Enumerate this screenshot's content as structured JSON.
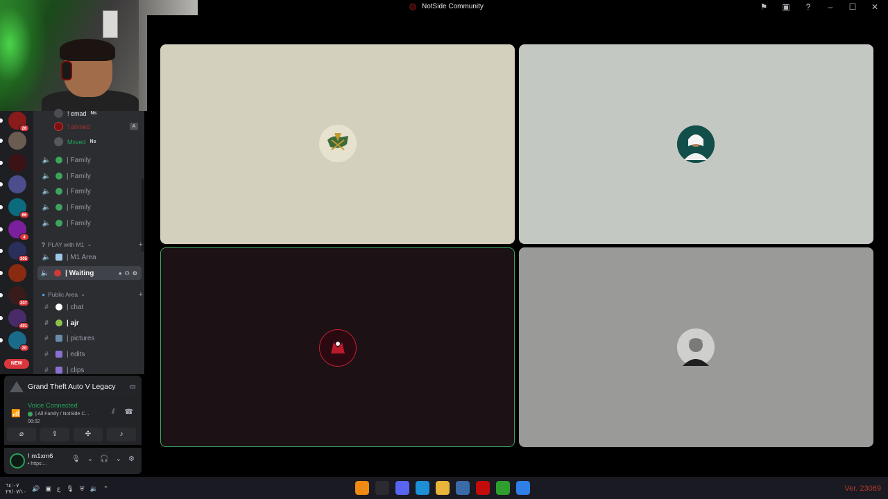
{
  "window": {
    "title": "NotSide Community",
    "titlebar_icons": [
      "inbox-flag-icon",
      "screen-share-icon",
      "help-icon",
      "minimize-icon",
      "maximize-icon",
      "close-icon"
    ]
  },
  "servers": [
    {
      "name": "m1-server",
      "badge": "26",
      "color": "#8a1b1b"
    },
    {
      "name": "server-2",
      "badge": "",
      "color": "#6a5c50"
    },
    {
      "name": "server-3",
      "badge": "",
      "color": "#3b1216"
    },
    {
      "name": "server-4",
      "badge": "",
      "color": "#4b4d8c"
    },
    {
      "name": "server-5",
      "badge": "66",
      "color": "#0c6a7d"
    },
    {
      "name": "server-6",
      "badge": "4",
      "color": "#7b1f9c"
    },
    {
      "name": "server-7",
      "badge": "305",
      "color": "#2b2f5c"
    },
    {
      "name": "server-8",
      "badge": "",
      "color": "#8a2a10"
    },
    {
      "name": "server-9",
      "badge": "207",
      "color": "#3a1b1b"
    },
    {
      "name": "server-10",
      "badge": "491",
      "color": "#4a2b6a"
    },
    {
      "name": "server-11",
      "badge": "20",
      "color": "#1a6a8a"
    }
  ],
  "new_badge": "NEW",
  "voice_users": [
    {
      "name": "! emad",
      "tag": "Ns",
      "color": "#e8e8e8",
      "avatar": "#4a4d52"
    },
    {
      "name": "! ahmed",
      "tag": "",
      "color": "#a83232",
      "avatar": "#7a1010"
    },
    {
      "name": "Mxved",
      "tag": "Ns",
      "color": "#23a55a",
      "avatar": "#55585d"
    }
  ],
  "voice_channels": [
    {
      "name": "| Family"
    },
    {
      "name": "| Family"
    },
    {
      "name": "| Family"
    },
    {
      "name": "| Family"
    },
    {
      "name": "| Family"
    }
  ],
  "categories": {
    "play": "PLAY with M1",
    "public": "Public Area"
  },
  "play_channels": [
    {
      "name": "| M1 Area",
      "active": false
    },
    {
      "name": "| Waiting",
      "active": true
    }
  ],
  "text_channels": [
    {
      "name": "| chat",
      "unread": false
    },
    {
      "name": "| ajr",
      "unread": true
    },
    {
      "name": "| pictures",
      "unread": false
    },
    {
      "name": "| edits",
      "unread": false
    },
    {
      "name": "| clips",
      "unread": false
    }
  ],
  "activity": {
    "game": "Grand Theft Auto V Legacy"
  },
  "voice": {
    "status": "Voice Connected",
    "channel": "| All Family / NotSide C...",
    "elapsed": "08:02",
    "actions": [
      "camera-off-icon",
      "screen-share-icon",
      "activities-icon",
      "soundboard-icon"
    ]
  },
  "user": {
    "name": "! m1xm6",
    "status": "• https:..."
  },
  "taskbar": {
    "left_text": "٦٤:٠٧",
    "left_date": "٢٧/٠٧/١٠",
    "lang": "ع",
    "version": "Ver. 23069",
    "apps": [
      {
        "name": "vlc-icon",
        "color": "#f08a12"
      },
      {
        "name": "obs-icon",
        "color": "#2a2a30"
      },
      {
        "name": "discord-icon",
        "color": "#5865f2"
      },
      {
        "name": "edge-icon",
        "color": "#1c8fd6"
      },
      {
        "name": "chrome-icon",
        "color": "#e9b43a"
      },
      {
        "name": "store-icon",
        "color": "#3a6aa8"
      },
      {
        "name": "netflix-icon",
        "color": "#c20b0b"
      },
      {
        "name": "xbox-icon",
        "color": "#2e9e2e"
      },
      {
        "name": "windows-icon",
        "color": "#2f7fe6"
      }
    ]
  },
  "colors": {
    "accent_green": "#23a55a",
    "speaking_border": "#3ba55d",
    "notification_red": "#da373c"
  }
}
